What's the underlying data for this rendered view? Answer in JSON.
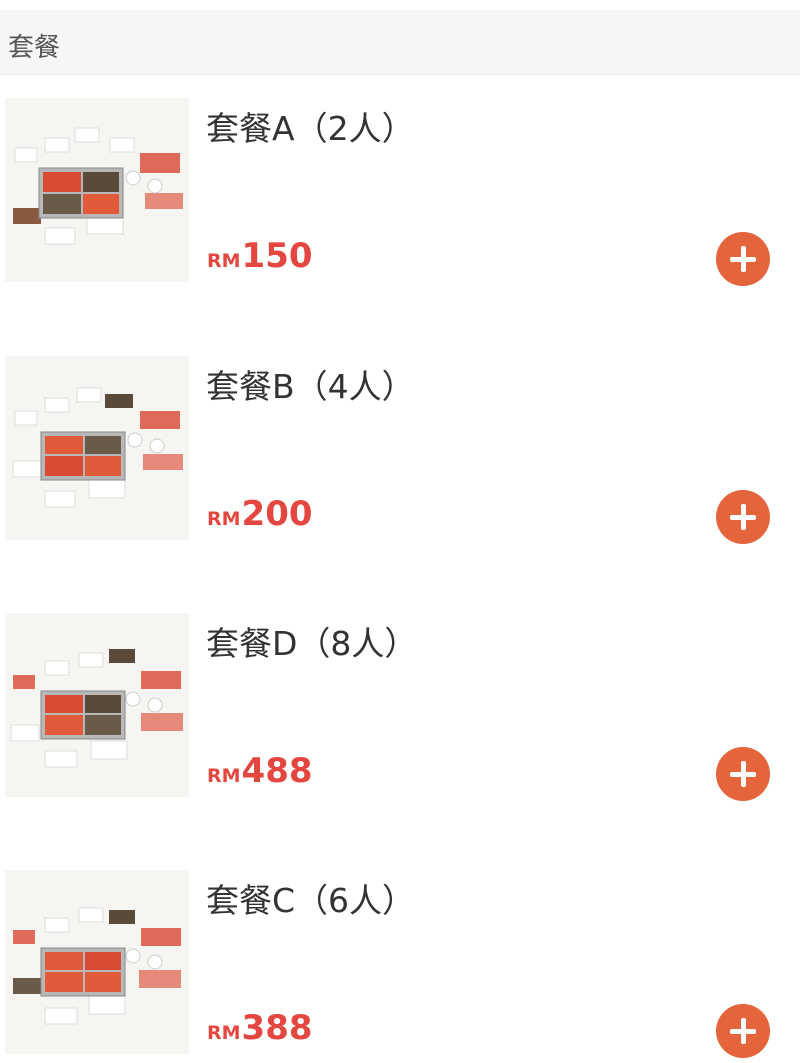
{
  "header": {
    "title": "套餐"
  },
  "items": [
    {
      "name": "套餐A（2人）",
      "currency": "RM",
      "price": "150",
      "add_icon": "plus-circle-icon"
    },
    {
      "name": "套餐B（4人）",
      "currency": "RM",
      "price": "200",
      "add_icon": "plus-circle-icon"
    },
    {
      "name": "套餐D（8人）",
      "currency": "RM",
      "price": "488",
      "add_icon": "plus-circle-icon"
    },
    {
      "name": "套餐C（6人）",
      "currency": "RM",
      "price": "388",
      "add_icon": "plus-circle-icon"
    }
  ],
  "colors": {
    "price": "#e4473f",
    "add_button": "#e4643c",
    "header_bg": "#f6f6f6"
  }
}
